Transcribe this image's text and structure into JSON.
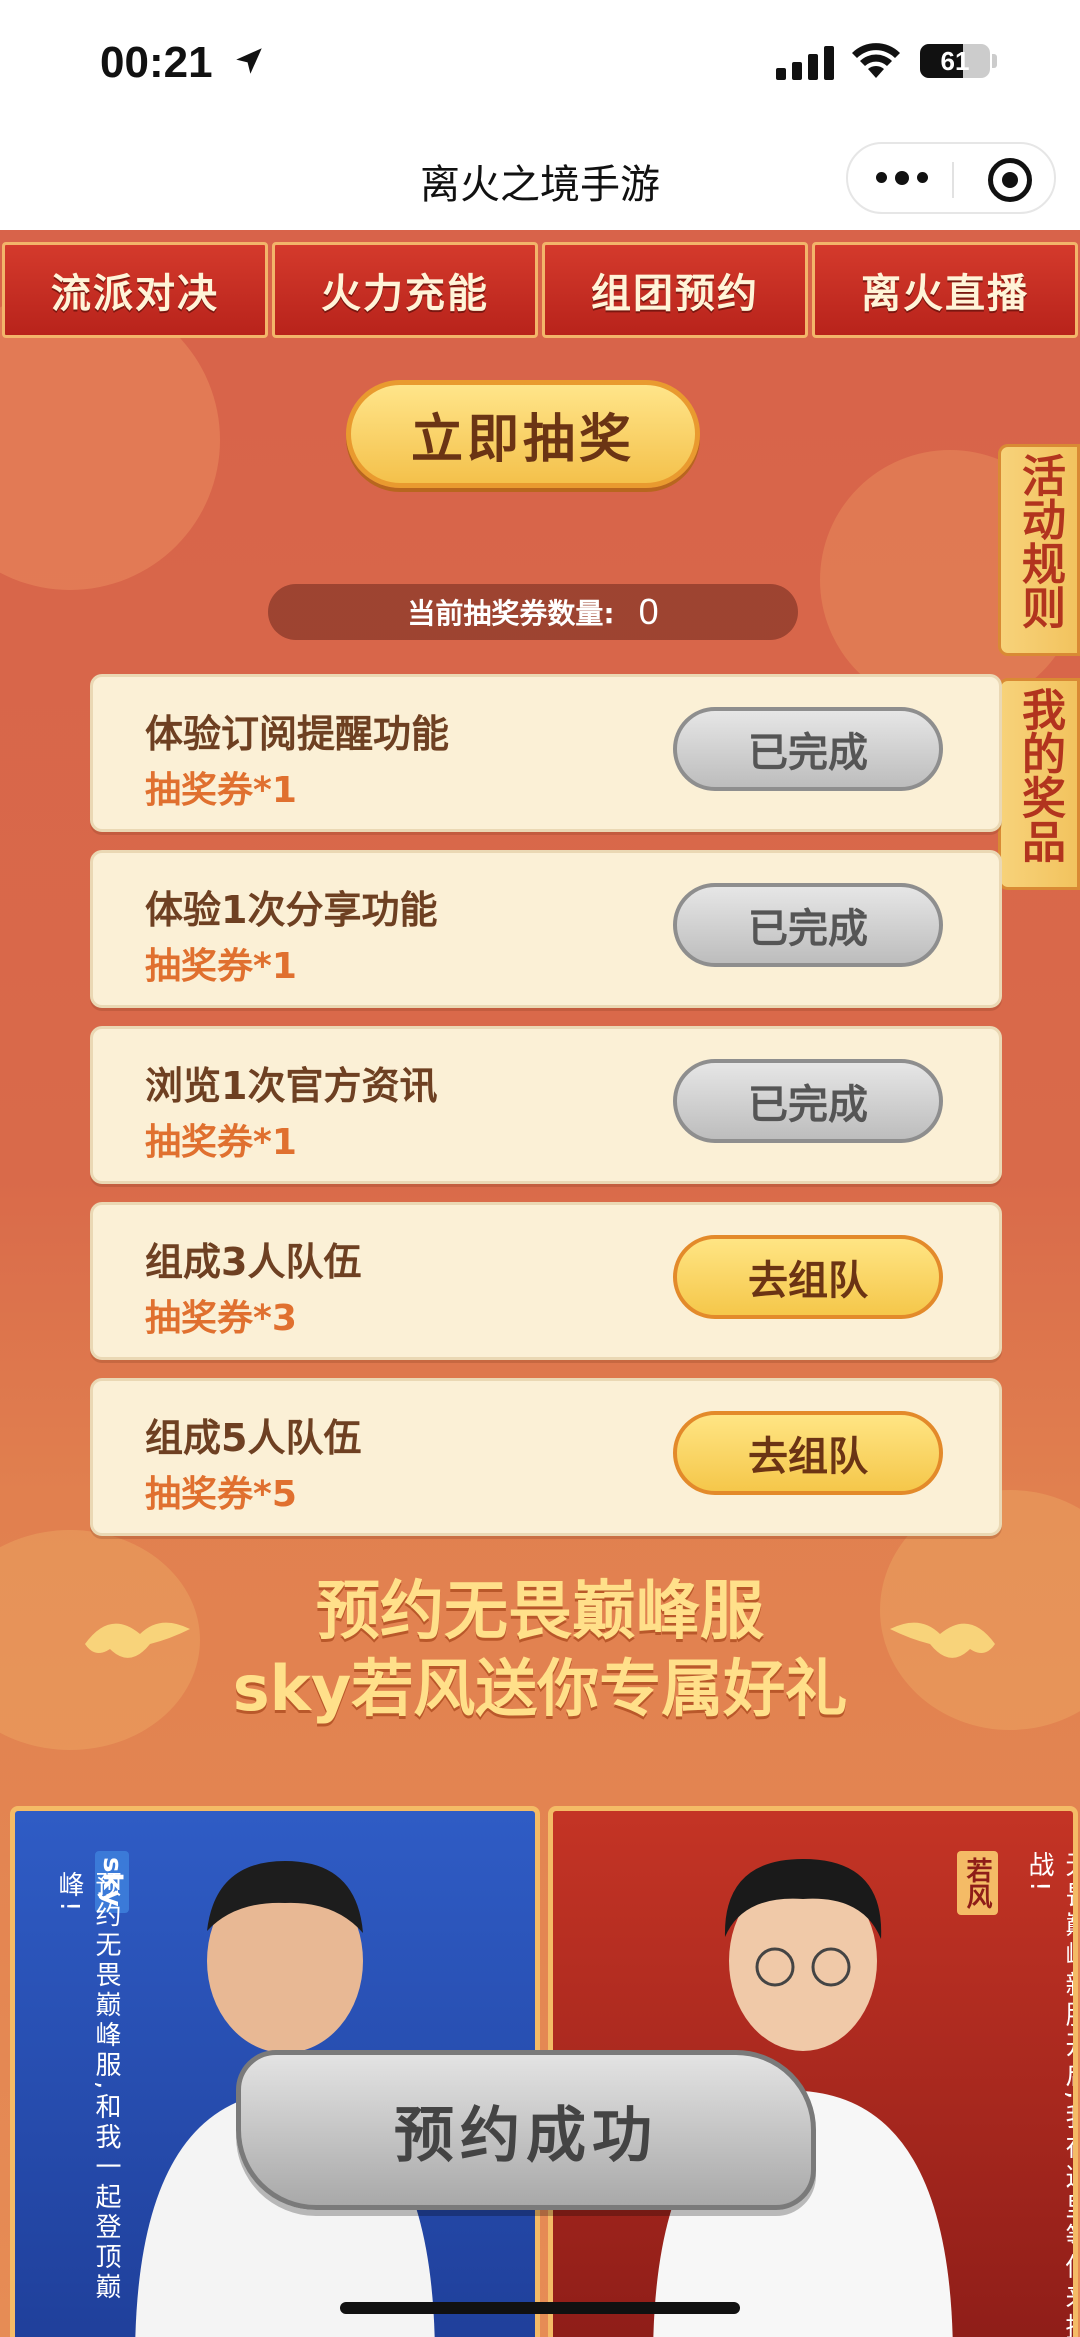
{
  "status_bar": {
    "time": "00:21",
    "battery": "61",
    "battery_level": 0.61
  },
  "nav": {
    "title": "离火之境手游"
  },
  "tabs": [
    "流派对决",
    "火力充能",
    "组团预约",
    "离火直播"
  ],
  "draw_button": "立即抽奖",
  "side_tabs": {
    "rules": "活动规则",
    "prizes": "我的奖品"
  },
  "ticket": {
    "label": "当前抽奖券数量:",
    "count": "0"
  },
  "tasks": [
    {
      "title": "体验订阅提醒功能",
      "reward": "抽奖券*1",
      "button": "已完成",
      "state": "done"
    },
    {
      "title": "体验1次分享功能",
      "reward": "抽奖券*1",
      "button": "已完成",
      "state": "done"
    },
    {
      "title": "浏览1次官方资讯",
      "reward": "抽奖券*1",
      "button": "已完成",
      "state": "done"
    },
    {
      "title": "组成3人队伍",
      "reward": "抽奖券*3",
      "button": "去组队",
      "state": "go"
    },
    {
      "title": "组成5人队伍",
      "reward": "抽奖券*5",
      "button": "去组队",
      "state": "go"
    }
  ],
  "promo": {
    "line1": "预约无畏巅峰服",
    "line2": "sky若风送你专属好礼"
  },
  "portraits": {
    "left": {
      "name": "sky",
      "text": "预约无畏巅峰服,和我一起登顶巅峰!"
    },
    "right": {
      "name": "若风",
      "text": "无畏巅峰新服开启,我在这里等你来挑战!"
    }
  },
  "success_banner": "预约成功",
  "colors": {
    "accent_orange": "#e0702f",
    "card_bg": "#fbf0d6",
    "gold": "#f4c14b"
  }
}
